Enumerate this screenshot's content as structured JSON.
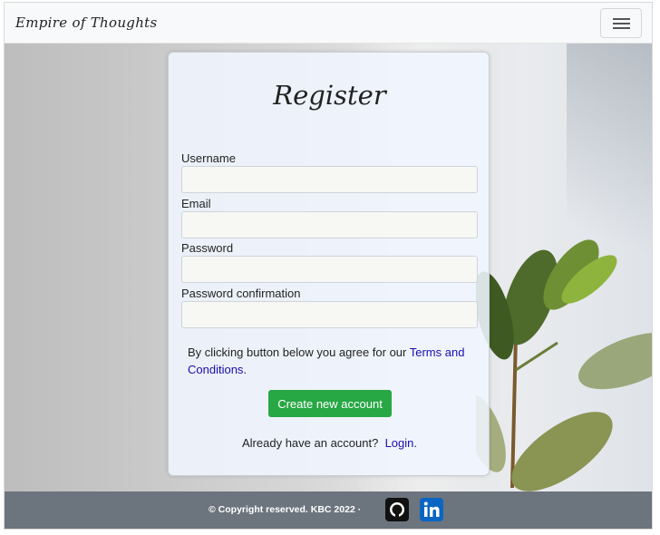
{
  "navbar": {
    "brand": "Empire of Thoughts",
    "toggle_icon": "hamburger-menu-icon"
  },
  "form": {
    "title": "Register",
    "fields": [
      {
        "label": "Username",
        "value": "",
        "placeholder": ""
      },
      {
        "label": "Email",
        "value": "",
        "placeholder": ""
      },
      {
        "label": "Password",
        "value": "",
        "placeholder": ""
      },
      {
        "label": "Password confirmation",
        "value": "",
        "placeholder": ""
      }
    ],
    "terms_text": "By clicking button below you agree for our",
    "terms_link": "Terms and Conditions",
    "terms_end": ".",
    "submit_label": "Create new account",
    "login_prompt": "Already have an account?",
    "login_link": "Login",
    "login_end": "."
  },
  "footer": {
    "copyright": "© Copyright reserved. KBC 2022 ·",
    "social": [
      {
        "icon": "github-icon"
      },
      {
        "icon": "linkedin-icon"
      }
    ]
  },
  "colors": {
    "accent_button": "#28a745",
    "link": "#1a0dab",
    "footer_bg": "#6c757d"
  }
}
